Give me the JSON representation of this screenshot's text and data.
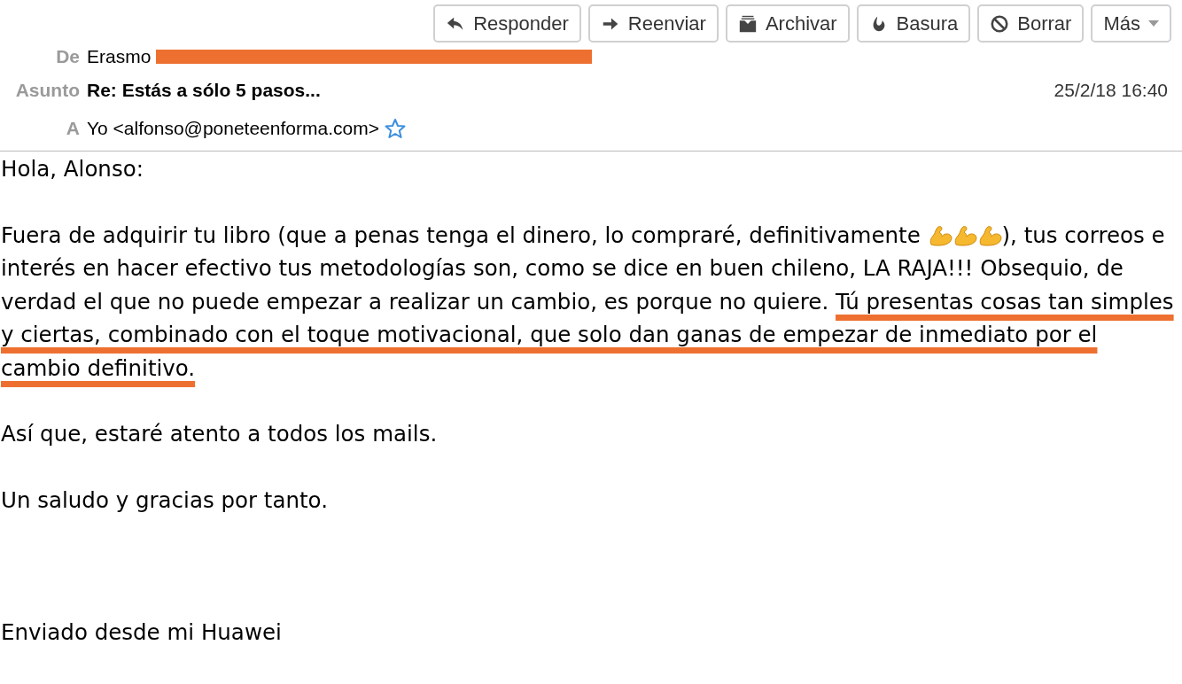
{
  "toolbar": [
    {
      "kind": "reply",
      "label": "Responder"
    },
    {
      "kind": "forward",
      "label": "Reenviar"
    },
    {
      "kind": "archive",
      "label": "Archivar"
    },
    {
      "kind": "junk",
      "label": "Basura"
    },
    {
      "kind": "delete",
      "label": "Borrar"
    },
    {
      "kind": "more",
      "label": "Más"
    }
  ],
  "header": {
    "from": {
      "label": "De",
      "name": "Erasmo",
      "redacted": true
    },
    "subject": {
      "label": "Asunto",
      "value": "Re: Estás a sólo 5 pasos...",
      "date": "25/2/18 16:40"
    },
    "to": {
      "label": "A",
      "value": "Yo <alfonso@poneteenforma.com>",
      "starred": false
    }
  },
  "body": {
    "greeting": "Hola, Alonso:",
    "paragraph": {
      "before_emoji": "Fuera de adquirir tu libro (que a penas tenga el dinero, lo compraré, definitivamente ",
      "emojis": [
        {
          "kind": "flexed-biceps"
        },
        {
          "kind": "flexed-biceps"
        },
        {
          "kind": "flexed-biceps"
        }
      ],
      "segments": [
        {
          "text": "), tus correos e interés en hacer efectivo tus metodologías son, como se dice en buen chileno, LA RAJA!!! Obsequio, de verdad el que no puede empezar a realizar un cambio, es porque no quiere. ",
          "marked": false
        },
        {
          "text": "Tú presentas cosas tan simples y ciertas, combinado con el toque motivacional, que solo dan ganas de empezar de inmediato por el cambio definitivo.",
          "marked": true
        }
      ]
    },
    "lines": [
      "Así que, estaré atento a todos los mails.",
      "Un saludo y gracias por tanto."
    ],
    "signature": "Enviado desde mi Huawei"
  }
}
